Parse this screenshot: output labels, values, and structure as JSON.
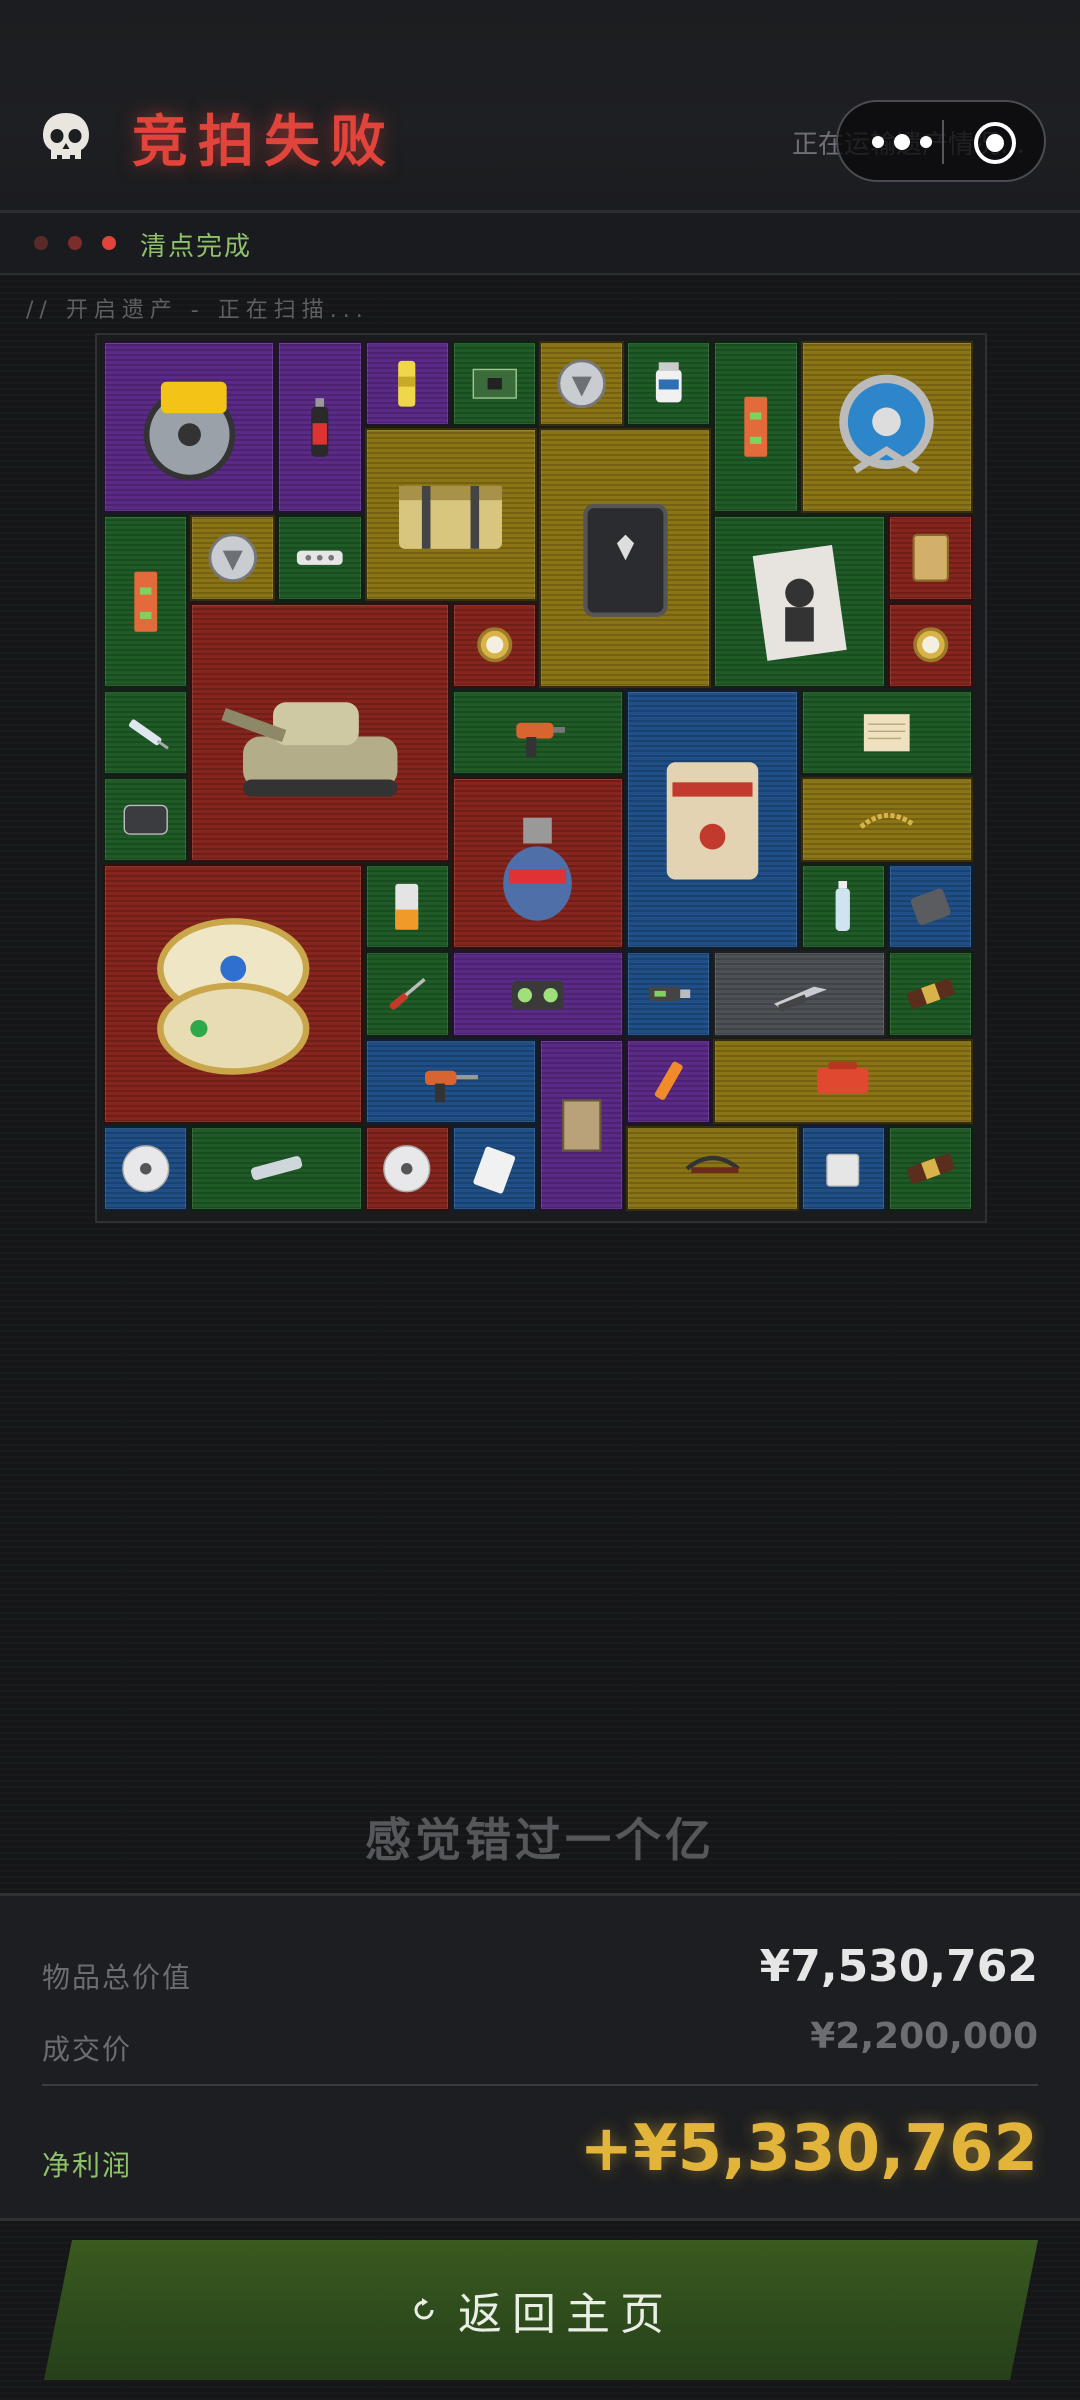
{
  "header": {
    "skull_icon": "skull-icon",
    "title": "竞拍失败",
    "subtitle": "正在运输遗产情况...",
    "capsule_icons": [
      "more-dots-icon",
      "target-icon"
    ]
  },
  "status": {
    "dot_colors": [
      "#5a2a28",
      "#7a2d2a",
      "#e0443a"
    ],
    "text": "清点完成"
  },
  "scan_text": "// 开启遗产 - 正在扫描...",
  "items": [
    {
      "name": "circular-saw-icon",
      "color": "purple"
    },
    {
      "name": "spray-can-icon",
      "color": "purple"
    },
    {
      "name": "energy-drink-icon",
      "color": "purple"
    },
    {
      "name": "circuit-board-icon",
      "color": "green"
    },
    {
      "name": "silver-coin-icon",
      "color": "gold"
    },
    {
      "name": "pill-bottle-icon",
      "color": "green"
    },
    {
      "name": "wall-level-icon",
      "color": "green"
    },
    {
      "name": "cable-reel-icon",
      "color": "gold"
    },
    {
      "name": "military-crate-icon",
      "color": "gold"
    },
    {
      "name": "black-case-icon",
      "color": "gold"
    },
    {
      "name": "wall-level-icon",
      "color": "green"
    },
    {
      "name": "silver-coin-icon",
      "color": "gold"
    },
    {
      "name": "power-strip-icon",
      "color": "green"
    },
    {
      "name": "magazine-icon",
      "color": "green"
    },
    {
      "name": "gold-card-icon",
      "color": "red"
    },
    {
      "name": "battle-tank-icon",
      "color": "red"
    },
    {
      "name": "gold-watch-icon",
      "color": "red"
    },
    {
      "name": "gold-watch-icon",
      "color": "red"
    },
    {
      "name": "syringe-icon",
      "color": "green"
    },
    {
      "name": "power-drill-icon",
      "color": "green"
    },
    {
      "name": "cement-bag-icon",
      "color": "blue"
    },
    {
      "name": "old-paper-icon",
      "color": "green"
    },
    {
      "name": "hard-drive-icon",
      "color": "green"
    },
    {
      "name": "gas-canister-icon",
      "color": "red"
    },
    {
      "name": "gold-chain-icon",
      "color": "gold"
    },
    {
      "name": "jeweled-egg-icon",
      "color": "red"
    },
    {
      "name": "battery-icon",
      "color": "green"
    },
    {
      "name": "water-bottle-icon",
      "color": "green"
    },
    {
      "name": "power-bank-icon",
      "color": "blue"
    },
    {
      "name": "screwdriver-icon",
      "color": "green"
    },
    {
      "name": "boombox-icon",
      "color": "purple"
    },
    {
      "name": "usb-stick-icon",
      "color": "blue"
    },
    {
      "name": "utility-knife-icon",
      "color": "gray"
    },
    {
      "name": "chocolate-bar-icon",
      "color": "green"
    },
    {
      "name": "cordless-drill-icon",
      "color": "blue"
    },
    {
      "name": "old-map-icon",
      "color": "purple"
    },
    {
      "name": "lighter-icon",
      "color": "purple"
    },
    {
      "name": "tool-case-icon",
      "color": "gold"
    },
    {
      "name": "cd-disc-icon",
      "color": "blue"
    },
    {
      "name": "glass-tube-icon",
      "color": "green"
    },
    {
      "name": "cd-disc-icon",
      "color": "red"
    },
    {
      "name": "memory-card-icon",
      "color": "blue"
    },
    {
      "name": "crossbow-icon",
      "color": "gold"
    },
    {
      "name": "sugar-cubes-icon",
      "color": "blue"
    },
    {
      "name": "chocolate-bar-icon",
      "color": "green"
    }
  ],
  "tagline": "感觉错过一个亿",
  "summary": {
    "total_label": "物品总价值",
    "total_value": "¥7,530,762",
    "deal_label": "成交价",
    "deal_value": "¥2,200,000",
    "profit_label": "净利润",
    "profit_value": "+¥5,330,762"
  },
  "home_button": {
    "label": "返回主页",
    "icon": "refresh-icon"
  },
  "colors": {
    "title_red": "#e0443a",
    "status_green": "#8fc06a",
    "profit_gold": "#e2b43a",
    "total_white": "#e6e6e6",
    "deal_gray": "#6b6d71"
  }
}
